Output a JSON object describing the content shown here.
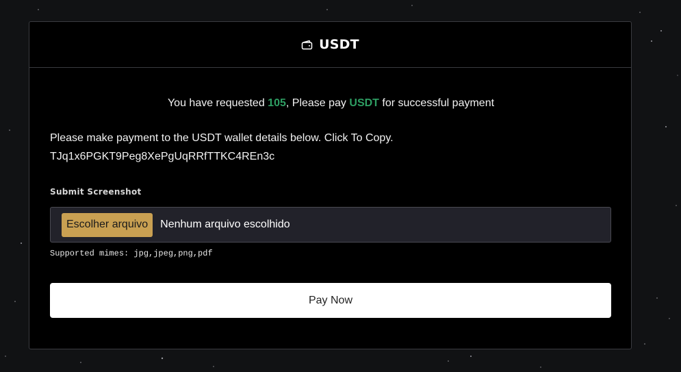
{
  "header": {
    "icon": "wallet-icon",
    "title": "USDT"
  },
  "request": {
    "prefix": "You have requested",
    "amount": "105",
    "middle": ", Please pay",
    "currency": "USDT",
    "suffix": "for successful payment"
  },
  "instruction": "Please make payment to the USDT wallet details below. Click To Copy.",
  "wallet_address": "TJq1x6PGKT9Peg8XePgUqRRfTTKC4REn3c",
  "upload": {
    "label": "Submit Screenshot",
    "button_label": "Escolher arquivo",
    "status": "Nenhum arquivo escolhido",
    "supported": "Supported mimes: jpg,jpeg,png,pdf"
  },
  "pay_button": "Pay Now",
  "colors": {
    "background": "#111214",
    "card": "#000000",
    "accent_green": "#2e9e63",
    "file_button": "#c9a052"
  }
}
